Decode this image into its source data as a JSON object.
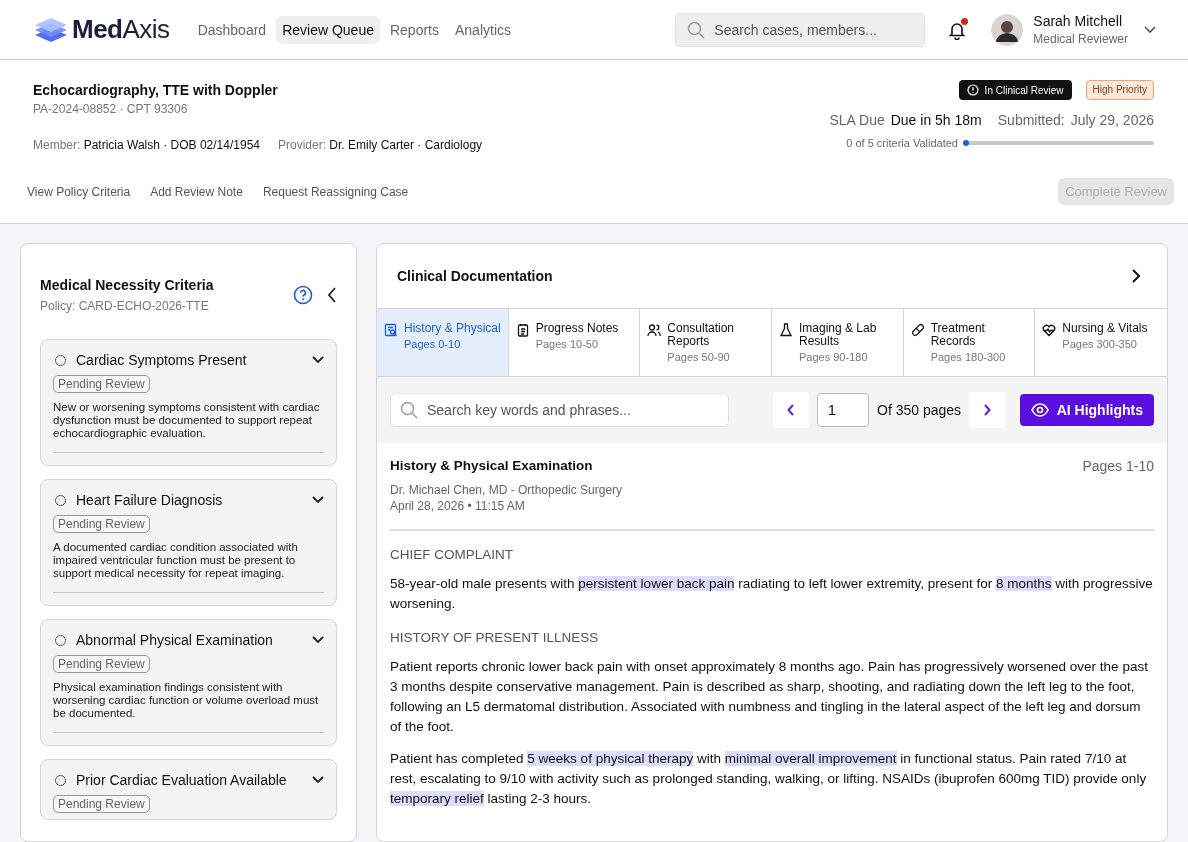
{
  "brand": {
    "name_bold": "Med",
    "name_light": "Axis"
  },
  "nav": [
    {
      "label": "Dashboard",
      "selected": false
    },
    {
      "label": "Review Queue",
      "selected": true
    },
    {
      "label": "Reports",
      "selected": false
    },
    {
      "label": "Analytics",
      "selected": false
    }
  ],
  "search": {
    "placeholder": "Search cases, members..."
  },
  "notifications": {
    "unread": true
  },
  "user": {
    "name": "Sarah Mitchell",
    "role": "Medical Reviewer"
  },
  "case": {
    "title": "Echocardiography, TTE with Doppler",
    "id": "PA-2024-08852 · CPT 93306",
    "member_label": "Member:",
    "member": "Patricia Walsh · DOB 02/14/1954",
    "provider_label": "Provider:",
    "provider": "Dr. Emily Carter · Cardiology",
    "status": "In Clinical Review",
    "priority": "High Priority",
    "sla_label": "SLA Due",
    "sla": "Due in 5h 18m",
    "submitted_label": "Submitted:",
    "submitted": "July 29, 2026",
    "progress_text": "0 of 5 criteria Validated",
    "progress": {
      "level": 0
    },
    "actions": [
      "View Policy Criteria",
      "Add Review Note",
      "Request Reassigning Case"
    ],
    "complete_button": {
      "label": "Complete Review",
      "disabled": true
    }
  },
  "criteria_panel": {
    "title": "Medical Necessity Criteria",
    "policy": "Policy: CARD-ECHO-2026-TTE",
    "items": [
      {
        "title": "Cardiac Symptoms Present",
        "checked": false,
        "expanded": false,
        "status": "Pending Review",
        "description": "New or worsening symptoms consistent with cardiac dysfunction must be documented to support repeat echocardiographic evaluation."
      },
      {
        "title": "Heart Failure Diagnosis",
        "checked": false,
        "expanded": false,
        "status": "Pending Review",
        "description": "A documented cardiac condition associated with impaired ventricular function must be present to support medical necessity for repeat imaging."
      },
      {
        "title": "Abnormal Physical Examination",
        "checked": false,
        "expanded": false,
        "status": "Pending Review",
        "description": "Physical examination findings consistent with worsening cardiac function or volume overload must be documented."
      },
      {
        "title": "Prior Cardiac Evaluation Available",
        "checked": false,
        "expanded": false,
        "status": "Pending Review"
      }
    ]
  },
  "documentation": {
    "title": "Clinical Documentation",
    "tabs": [
      {
        "label": "History & Physical",
        "pages": "Pages 0-10",
        "selected": true
      },
      {
        "label": "Progress Notes",
        "pages": "Pages 10-50",
        "selected": false
      },
      {
        "label": "Consultation Reports",
        "pages": "Pages 50-90",
        "selected": false
      },
      {
        "label": "Imaging & Lab Results",
        "pages": "Pages 90-180",
        "selected": false
      },
      {
        "label": "Treatment Records",
        "pages": "Pages 180-300",
        "selected": false
      },
      {
        "label": "Nursing & Vitals",
        "pages": "Pages 300-350",
        "selected": false
      }
    ],
    "search": {
      "placeholder": "Search key words and phrases..."
    },
    "page_input": "1",
    "page_total": "Of 350 pages",
    "ai_button": "AI Highlights",
    "document": {
      "title": "History & Physical Examination",
      "pages": "Pages 1-10",
      "author": "Dr. Michael Chen, MD - Orthopedic Surgery",
      "date": "April 28, 2026 • 11:15 AM",
      "sections": [
        {
          "heading": "CHIEF COMPLAINT",
          "paragraphs": [
            [
              {
                "text": "58-year-old male presents with ",
                "highlighted": false
              },
              {
                "text": "persistent lower back pain",
                "highlighted": true
              },
              {
                "text": " radiating to left lower extremity, present for ",
                "highlighted": false
              },
              {
                "text": "8 months",
                "highlighted": true
              },
              {
                "text": " with progressive worsening.",
                "highlighted": false
              }
            ]
          ]
        },
        {
          "heading": "HISTORY OF PRESENT ILLNESS",
          "paragraphs": [
            [
              {
                "text": "Patient reports chronic lower back pain with onset approximately 8 months ago. Pain has progressively worsened over the past 3 months despite conservative management. Pain is described as sharp, shooting, and radiating down the left leg to the foot, following an L5 dermatomal distribution. Associated with numbness and tingling in the lateral aspect of the left leg and dorsum of the foot.",
                "highlighted": false
              }
            ],
            [
              {
                "text": "Patient has completed ",
                "highlighted": false
              },
              {
                "text": "5 weeks of physical therapy",
                "highlighted": true
              },
              {
                "text": " with ",
                "highlighted": false
              },
              {
                "text": "minimal overall improvement",
                "highlighted": true
              },
              {
                "text": " in functional status. Pain rated 7/10 at rest, escalating to 9/10 with activity such as prolonged standing, walking, or lifting. NSAIDs (ibuprofen 600mg TID) provide only ",
                "highlighted": false
              },
              {
                "text": "temporary relief",
                "highlighted": true
              },
              {
                "text": " lasting 2-3 hours.",
                "highlighted": false
              }
            ]
          ]
        }
      ]
    }
  }
}
